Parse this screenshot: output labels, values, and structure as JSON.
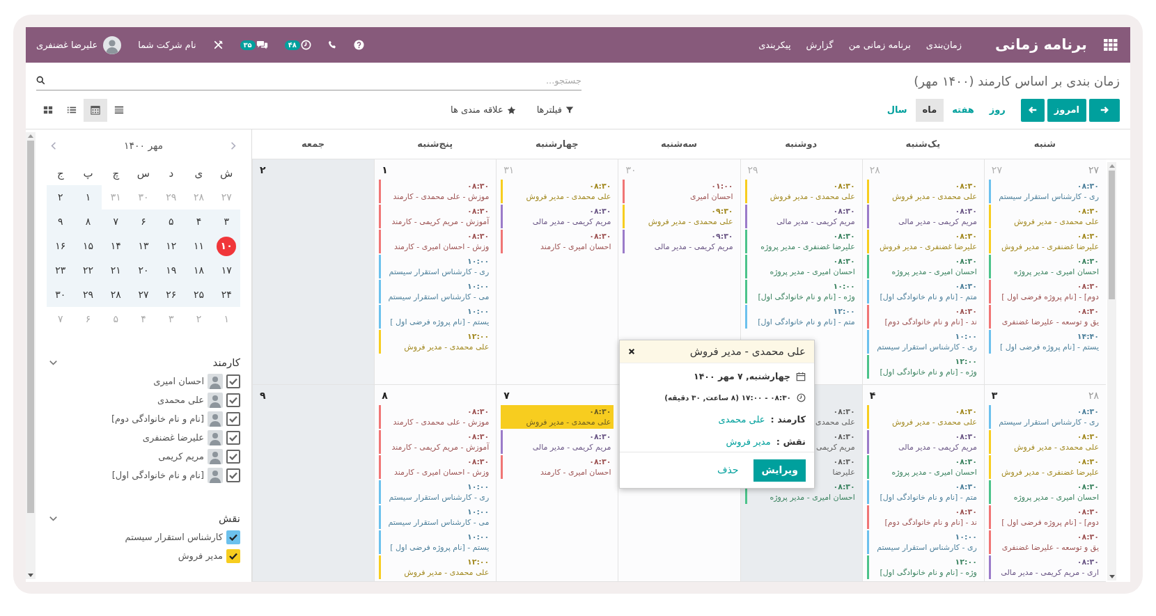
{
  "navbar": {
    "app_title": "برنامه زمانی",
    "menu": [
      "زمان‌بندی",
      "برنامه زمانی من",
      "گزارش",
      "پیکربندی"
    ],
    "activity_badge": "۴۸",
    "chat_badge": "۳۵",
    "company": "نام شرکت شما",
    "user": "علیرضا غضنفری"
  },
  "control_panel": {
    "title": "زمان بندی بر اساس کارمند (۱۴۰۰ مهر)",
    "search": {
      "placeholder": "جستجو..."
    },
    "today": "امروز",
    "scales": [
      {
        "label": "روز",
        "selected": false
      },
      {
        "label": "هفته",
        "selected": false
      },
      {
        "label": "ماه",
        "selected": true
      },
      {
        "label": "سال",
        "selected": false
      }
    ],
    "filters": "فیلترها",
    "favorites": "علاقه مندی ها",
    "views": [
      {
        "kind": "gantt",
        "selected": false
      },
      {
        "kind": "calendar",
        "selected": true
      },
      {
        "kind": "list",
        "selected": false
      },
      {
        "kind": "kanban",
        "selected": false
      }
    ]
  },
  "calendar": {
    "weekdays": [
      "شنبه",
      "یک‌شنبه",
      "دوشنبه",
      "سه‌شنبه",
      "چهارشنبه",
      "پنج‌شنبه",
      "جمعه"
    ],
    "weeks": [
      {
        "week_number": "۲۷",
        "days": [
          {
            "day": "۲۷",
            "other_month": true,
            "shaded": false,
            "events": [
              {
                "time": "۰۸:۳۰",
                "title": "ری - کارشناس استقرار سیستم",
                "color": "#6cc1ed",
                "selected": false
              },
              {
                "time": "۰۸:۳۰",
                "title": "علی محمدی - مدیر فروش",
                "color": "#f7cd1f",
                "selected": false
              },
              {
                "time": "۰۸:۳۰",
                "title": "علیرضا غضنفری - مدیر فروش",
                "color": "#f7cd1f",
                "selected": false
              },
              {
                "time": "۰۸:۳۰",
                "title": "احسان امیری - مدیر پروژه",
                "color": "#4cc38a",
                "selected": false
              },
              {
                "time": "۰۸:۳۰",
                "title": "دوم] - [نام پروژه فرضی اول ]",
                "color": "#f07575",
                "selected": false
              },
              {
                "time": "۰۸:۳۰",
                "title": "یق و توسعه - علیرضا غضنفری",
                "color": "#f07575",
                "selected": false
              },
              {
                "time": "۱۴:۴۰",
                "title": "یستم - [نام پروژه فرضی اول ]",
                "color": "#6cc1ed",
                "selected": false
              }
            ]
          },
          {
            "day": "۲۸",
            "other_month": true,
            "shaded": false,
            "events": [
              {
                "time": "۰۸:۳۰",
                "title": "علی محمدی - مدیر فروش",
                "color": "#f7cd1f",
                "selected": false
              },
              {
                "time": "۰۸:۳۰",
                "title": "مریم کریمی - مدیر مالی",
                "color": "#9b7bc9",
                "selected": false
              },
              {
                "time": "۰۸:۳۰",
                "title": "علیرضا غضنفری - مدیر فروش",
                "color": "#f7cd1f",
                "selected": false
              },
              {
                "time": "۰۸:۳۰",
                "title": "احسان امیری - مدیر پروژه",
                "color": "#4cc38a",
                "selected": false
              },
              {
                "time": "۰۸:۳۰",
                "title": "متم - [نام و نام خانوادگی اول]",
                "color": "#6cc1ed",
                "selected": false
              },
              {
                "time": "۰۸:۳۰",
                "title": "ند - [نام و نام خانوادگی دوم]",
                "color": "#f07575",
                "selected": false
              },
              {
                "time": "۱۰:۰۰",
                "title": "ری - کارشناس استقرار سیستم",
                "color": "#6cc1ed",
                "selected": false
              },
              {
                "time": "۱۲:۰۰",
                "title": "وژه - [نام و نام خانوادگی اول]",
                "color": "#4cc38a",
                "selected": false
              }
            ]
          },
          {
            "day": "۲۹",
            "other_month": true,
            "shaded": false,
            "events": [
              {
                "time": "۰۸:۳۰",
                "title": "علی محمدی - مدیر فروش",
                "color": "#f7cd1f",
                "selected": false
              },
              {
                "time": "۰۸:۳۰",
                "title": "مریم کریمی - مدیر مالی",
                "color": "#9b7bc9",
                "selected": false
              },
              {
                "time": "۰۸:۳۰",
                "title": "علیرضا غضنفری - مدیر پروژه",
                "color": "#4cc38a",
                "selected": false
              },
              {
                "time": "۰۸:۳۰",
                "title": "احسان امیری - مدیر پروژه",
                "color": "#4cc38a",
                "selected": false
              },
              {
                "time": "۱۰:۰۰",
                "title": "وژه - [نام و نام خانوادگی اول]",
                "color": "#4cc38a",
                "selected": false
              },
              {
                "time": "۱۲:۰۰",
                "title": "متم - [نام و نام خانوادگی اول]",
                "color": "#6cc1ed",
                "selected": false
              }
            ]
          },
          {
            "day": "۳۰",
            "other_month": true,
            "shaded": false,
            "events": [
              {
                "time": "۰۱:۰۰",
                "title": "احسان امیری",
                "color": "#f07575",
                "selected": false
              },
              {
                "time": "۰۹:۳۰",
                "title": "علی محمدی - مدیر فروش",
                "color": "#f7cd1f",
                "selected": false
              },
              {
                "time": "۰۹:۳۰",
                "title": "مریم کریمی - مدیر مالی",
                "color": "#9b7bc9",
                "selected": false
              }
            ]
          },
          {
            "day": "۳۱",
            "other_month": true,
            "shaded": false,
            "events": [
              {
                "time": "۰۸:۳۰",
                "title": "علی محمدی - مدیر فروش",
                "color": "#f7cd1f",
                "selected": false
              },
              {
                "time": "۰۸:۳۰",
                "title": "مریم کریمی - مدیر مالی",
                "color": "#9b7bc9",
                "selected": false
              },
              {
                "time": "۰۸:۳۰",
                "title": "احسان امیری - کارمند",
                "color": "#f07575",
                "selected": false
              }
            ]
          },
          {
            "day": "۱",
            "other_month": false,
            "shaded": false,
            "events": [
              {
                "time": "۰۸:۳۰",
                "title": "موزش - علی محمدی - کارمند",
                "color": "#f07575",
                "selected": false
              },
              {
                "time": "۰۸:۳۰",
                "title": "آموزش - مریم کریمی - کارمند",
                "color": "#f07575",
                "selected": false
              },
              {
                "time": "۰۸:۳۰",
                "title": "وزش - احسان امیری - کارمند",
                "color": "#f07575",
                "selected": false
              },
              {
                "time": "۱۰:۰۰",
                "title": "ری - کارشناس استقرار سیستم",
                "color": "#6cc1ed",
                "selected": false
              },
              {
                "time": "۱۰:۰۰",
                "title": "می - کارشناس استقرار سیستم",
                "color": "#6cc1ed",
                "selected": false
              },
              {
                "time": "۱۰:۰۰",
                "title": "یستم - [نام پروژه فرضی اول ]",
                "color": "#6cc1ed",
                "selected": false
              },
              {
                "time": "۱۲:۰۰",
                "title": "علی محمدی - مدیر فروش",
                "color": "#f7cd1f",
                "selected": false
              }
            ]
          },
          {
            "day": "۲",
            "other_month": false,
            "shaded": true
          }
        ]
      },
      {
        "week_number": "۲۸",
        "days": [
          {
            "day": "۳",
            "other_month": false,
            "shaded": false,
            "events": [
              {
                "time": "۰۸:۳۰",
                "title": "ری - کارشناس استقرار سیستم",
                "color": "#6cc1ed",
                "selected": false
              },
              {
                "time": "۰۸:۳۰",
                "title": "علی محمدی - مدیر فروش",
                "color": "#f7cd1f",
                "selected": false
              },
              {
                "time": "۰۸:۳۰",
                "title": "علیرضا غضنفری - مدیر فروش",
                "color": "#f7cd1f",
                "selected": false
              },
              {
                "time": "۰۸:۳۰",
                "title": "احسان امیری - مدیر پروژه",
                "color": "#4cc38a",
                "selected": false
              },
              {
                "time": "۰۸:۳۰",
                "title": "دوم] - [نام پروژه فرضی اول ]",
                "color": "#f07575",
                "selected": false
              },
              {
                "time": "۰۸:۳۰",
                "title": "یق و توسعه - علیرضا غضنفری",
                "color": "#f07575",
                "selected": false
              },
              {
                "time": "۰۸:۳۰",
                "title": "اری - مریم کریمی - مدیر مالی",
                "color": "#9b7bc9",
                "selected": false
              }
            ]
          },
          {
            "day": "۴",
            "other_month": false,
            "shaded": false,
            "events": [
              {
                "time": "۰۸:۳۰",
                "title": "علی محمدی - مدیر فروش",
                "color": "#f7cd1f",
                "selected": false
              },
              {
                "time": "۰۸:۳۰",
                "title": "مریم کریمی - مدیر مالی",
                "color": "#9b7bc9",
                "selected": false
              },
              {
                "time": "۰۸:۳۰",
                "title": "احسان امیری - مدیر پروژه",
                "color": "#4cc38a",
                "selected": false
              },
              {
                "time": "۰۸:۳۰",
                "title": "متم - [نام و نام خانوادگی اول]",
                "color": "#6cc1ed",
                "selected": false
              },
              {
                "time": "۰۸:۳۰",
                "title": "ند - [نام و نام خانوادگی دوم]",
                "color": "#f07575",
                "selected": false
              },
              {
                "time": "۱۰:۰۰",
                "title": "ری - کارشناس استقرار سیستم",
                "color": "#6cc1ed",
                "selected": false
              },
              {
                "time": "۱۲:۰۰",
                "title": "وژه - [نام و نام خانوادگی اول]",
                "color": "#4cc38a",
                "selected": false
              }
            ]
          },
          {
            "shaded": true,
            "events": [
              {
                "time": "۰۸:۳۰",
                "title": "علی محمدی",
                "selected": false
              },
              {
                "time": "۰۸:۳۰",
                "title": "مریم کریمی",
                "selected": false
              },
              {
                "time": "۰۸:۳۰",
                "title": "علیرضا",
                "selected": false
              },
              {
                "time": "۰۸:۳۰",
                "title": "احسان امیری - مدیر پروژه",
                "color": "#4cc38a",
                "selected": false
              }
            ]
          },
          {
            "shaded": false
          },
          {
            "day": "۷",
            "other_month": false,
            "shaded": false,
            "events": [
              {
                "time": "۰۸:۳۰",
                "title": "علی محمدی - مدیر فروش",
                "color": "#f7cd1f",
                "selected": true
              },
              {
                "time": "۰۸:۳۰",
                "title": "مریم کریمی - مدیر مالی",
                "color": "#9b7bc9",
                "selected": false
              },
              {
                "time": "۰۸:۳۰",
                "title": "احسان امیری - کارمند",
                "color": "#f07575",
                "selected": false
              }
            ]
          },
          {
            "day": "۸",
            "other_month": false,
            "shaded": false,
            "events": [
              {
                "time": "۰۸:۳۰",
                "title": "موزش - علی محمدی - کارمند",
                "color": "#f07575",
                "selected": false
              },
              {
                "time": "۰۸:۳۰",
                "title": "آموزش - مریم کریمی - کارمند",
                "color": "#f07575",
                "selected": false
              },
              {
                "time": "۰۸:۳۰",
                "title": "وزش - احسان امیری - کارمند",
                "color": "#f07575",
                "selected": false
              },
              {
                "time": "۱۰:۰۰",
                "title": "ری - کارشناس استقرار سیستم",
                "color": "#6cc1ed",
                "selected": false
              },
              {
                "time": "۱۰:۰۰",
                "title": "می - کارشناس استقرار سیستم",
                "color": "#6cc1ed",
                "selected": false
              },
              {
                "time": "۱۰:۰۰",
                "title": "یستم - [نام پروژه فرضی اول ]",
                "color": "#6cc1ed",
                "selected": false
              },
              {
                "time": "۱۲:۰۰",
                "title": "علی محمدی - مدیر فروش",
                "color": "#f7cd1f",
                "selected": false
              }
            ]
          },
          {
            "day": "۹",
            "other_month": false,
            "shaded": true
          }
        ]
      }
    ],
    "popover": {
      "title": "علی محمدی - مدیر فروش",
      "date": "چهارشنبه, ۷ مهر ۱۴۰۰",
      "time_range": "۰۸:۳۰ - ۱۷:۰۰ (۸ ساعت, ۳۰ دقیقه)",
      "fields": [
        {
          "label": "کارمند :",
          "value": "علی محمدی"
        },
        {
          "label": "نقش :",
          "value": "مدیر فروش"
        }
      ],
      "edit": "ویرایش",
      "delete": "حذف"
    }
  },
  "sidebar": {
    "mini_calendar": {
      "month_label": "مهر ۱۴۰۰",
      "weekdays": [
        "ش",
        "ی",
        "د",
        "س",
        "چ",
        "پ",
        "ج"
      ],
      "weeks": [
        [
          {
            "day": "۲۷",
            "other_month": true,
            "today": false
          },
          {
            "day": "۲۸",
            "other_month": true,
            "today": false
          },
          {
            "day": "۲۹",
            "other_month": true,
            "today": false
          },
          {
            "day": "۳۰",
            "other_month": true,
            "today": false
          },
          {
            "day": "۳۱",
            "other_month": true,
            "today": false
          },
          {
            "day": "۱",
            "other_month": false,
            "today": false
          },
          {
            "day": "۲",
            "other_month": false,
            "today": false
          }
        ],
        [
          {
            "day": "۳",
            "other_month": false,
            "today": false
          },
          {
            "day": "۴",
            "other_month": false,
            "today": false
          },
          {
            "day": "۵",
            "other_month": false,
            "today": false
          },
          {
            "day": "۶",
            "other_month": false,
            "today": false
          },
          {
            "day": "۷",
            "other_month": false,
            "today": false
          },
          {
            "day": "۸",
            "other_month": false,
            "today": false
          },
          {
            "day": "۹",
            "other_month": false,
            "today": false
          }
        ],
        [
          {
            "day": "۱۰",
            "other_month": false,
            "today": true
          },
          {
            "day": "۱۱",
            "other_month": false,
            "today": false
          },
          {
            "day": "۱۲",
            "other_month": false,
            "today": false
          },
          {
            "day": "۱۳",
            "other_month": false,
            "today": false
          },
          {
            "day": "۱۴",
            "other_month": false,
            "today": false
          },
          {
            "day": "۱۵",
            "other_month": false,
            "today": false
          },
          {
            "day": "۱۶",
            "other_month": false,
            "today": false
          }
        ],
        [
          {
            "day": "۱۷",
            "other_month": false,
            "today": false
          },
          {
            "day": "۱۸",
            "other_month": false,
            "today": false
          },
          {
            "day": "۱۹",
            "other_month": false,
            "today": false
          },
          {
            "day": "۲۰",
            "other_month": false,
            "today": false
          },
          {
            "day": "۲۱",
            "other_month": false,
            "today": false
          },
          {
            "day": "۲۲",
            "other_month": false,
            "today": false
          },
          {
            "day": "۲۳",
            "other_month": false,
            "today": false
          }
        ],
        [
          {
            "day": "۲۴",
            "other_month": false,
            "today": false
          },
          {
            "day": "۲۵",
            "other_month": false,
            "today": false
          },
          {
            "day": "۲۶",
            "other_month": false,
            "today": false
          },
          {
            "day": "۲۷",
            "other_month": false,
            "today": false
          },
          {
            "day": "۲۸",
            "other_month": false,
            "today": false
          },
          {
            "day": "۲۹",
            "other_month": false,
            "today": false
          },
          {
            "day": "۳۰",
            "other_month": false,
            "today": false
          }
        ],
        [
          {
            "day": "۱",
            "other_month": true,
            "today": false
          },
          {
            "day": "۲",
            "other_month": true,
            "today": false
          },
          {
            "day": "۳",
            "other_month": true,
            "today": false
          },
          {
            "day": "۴",
            "other_month": true,
            "today": false
          },
          {
            "day": "۵",
            "other_month": true,
            "today": false
          },
          {
            "day": "۶",
            "other_month": true,
            "today": false
          },
          {
            "day": "۷",
            "other_month": true,
            "today": false
          }
        ]
      ]
    },
    "filters": [
      {
        "title": "کارمند",
        "kind": "avatars",
        "expanded": true,
        "items": [
          {
            "label": "احسان امیری",
            "checked": true
          },
          {
            "label": "علی محمدی",
            "checked": true
          },
          {
            "label": "[نام و نام خانوادگی دوم]",
            "checked": true
          },
          {
            "label": "علیرضا غضنفری",
            "checked": true
          },
          {
            "label": "مریم کریمی",
            "checked": true
          },
          {
            "label": "[نام و نام خانوادگی اول]",
            "checked": true
          }
        ]
      },
      {
        "title": "نقش",
        "kind": "colors",
        "expanded": true,
        "items": [
          {
            "label": "کارشناس استقرار سیستم",
            "checked": true,
            "color": "#6cc1ed"
          },
          {
            "label": "مدیر فروش",
            "checked": true,
            "color": "#f7cd1f"
          }
        ]
      }
    ]
  }
}
